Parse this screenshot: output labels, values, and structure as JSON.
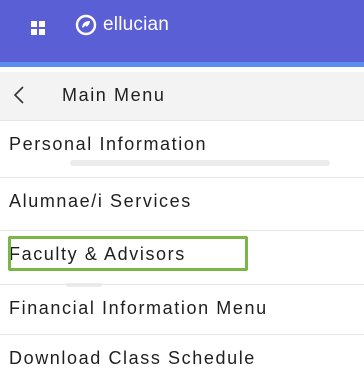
{
  "header": {
    "brand_name": "ellucian",
    "brand_color": "#5b5fd6",
    "accent_color": "#5e8df0",
    "menu_icon": "grid-menu-icon",
    "logo_icon": "ellucian-logo-icon"
  },
  "menu": {
    "back_icon": "chevron-left-icon",
    "back_label": "Main Menu",
    "items": [
      {
        "label": "Personal Information"
      },
      {
        "label": "Alumnae/i Services"
      },
      {
        "label": "Faculty & Advisors",
        "highlighted": true,
        "highlight_color": "#7ab648"
      },
      {
        "label": "Financial Information Menu"
      },
      {
        "label": "Download Class Schedule"
      }
    ]
  }
}
